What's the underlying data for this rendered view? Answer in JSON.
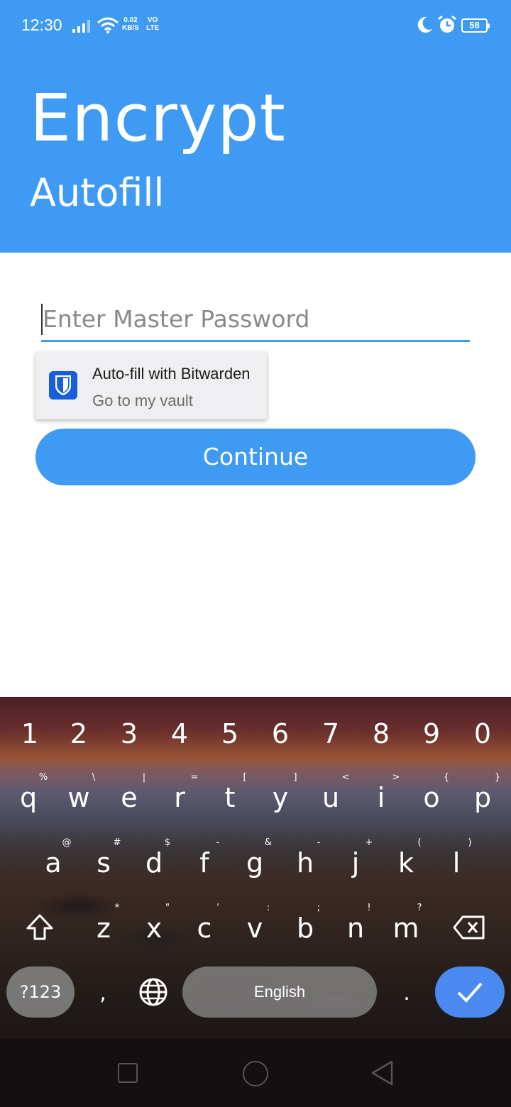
{
  "status_bar": {
    "time": "12:30",
    "net_speed_value": "0.02",
    "net_speed_unit": "KB/S",
    "volte_top": "VO",
    "volte_bottom": "LTE",
    "battery": "58"
  },
  "header": {
    "title": "Encrypt",
    "subtitle": "Autofill",
    "background_color": "#3f9af4"
  },
  "form": {
    "password_placeholder": "Enter Master Password",
    "continue_label": "Continue"
  },
  "autofill_popup": {
    "title": "Auto-fill with Bitwarden",
    "subtitle": "Go to my vault",
    "icon": "bitwarden-shield-icon"
  },
  "keyboard": {
    "number_row": [
      "1",
      "2",
      "3",
      "4",
      "5",
      "6",
      "7",
      "8",
      "9",
      "0"
    ],
    "row1": [
      {
        "key": "q",
        "hint": "%"
      },
      {
        "key": "w",
        "hint": "\\"
      },
      {
        "key": "e",
        "hint": "|"
      },
      {
        "key": "r",
        "hint": "="
      },
      {
        "key": "t",
        "hint": "["
      },
      {
        "key": "y",
        "hint": "]"
      },
      {
        "key": "u",
        "hint": "<"
      },
      {
        "key": "i",
        "hint": ">"
      },
      {
        "key": "o",
        "hint": "{"
      },
      {
        "key": "p",
        "hint": "}"
      }
    ],
    "row2": [
      {
        "key": "a",
        "hint": "@"
      },
      {
        "key": "s",
        "hint": "#"
      },
      {
        "key": "d",
        "hint": "$"
      },
      {
        "key": "f",
        "hint": "-"
      },
      {
        "key": "g",
        "hint": "&"
      },
      {
        "key": "h",
        "hint": "-"
      },
      {
        "key": "j",
        "hint": "+"
      },
      {
        "key": "k",
        "hint": "("
      },
      {
        "key": "l",
        "hint": ")"
      }
    ],
    "row3": [
      {
        "key": "z",
        "hint": "*"
      },
      {
        "key": "x",
        "hint": "\""
      },
      {
        "key": "c",
        "hint": "'"
      },
      {
        "key": "v",
        "hint": ":"
      },
      {
        "key": "b",
        "hint": ";"
      },
      {
        "key": "n",
        "hint": "!"
      },
      {
        "key": "m",
        "hint": "?"
      }
    ],
    "symbols_label": "?123",
    "comma": ",",
    "space_label": "English",
    "period": "."
  }
}
